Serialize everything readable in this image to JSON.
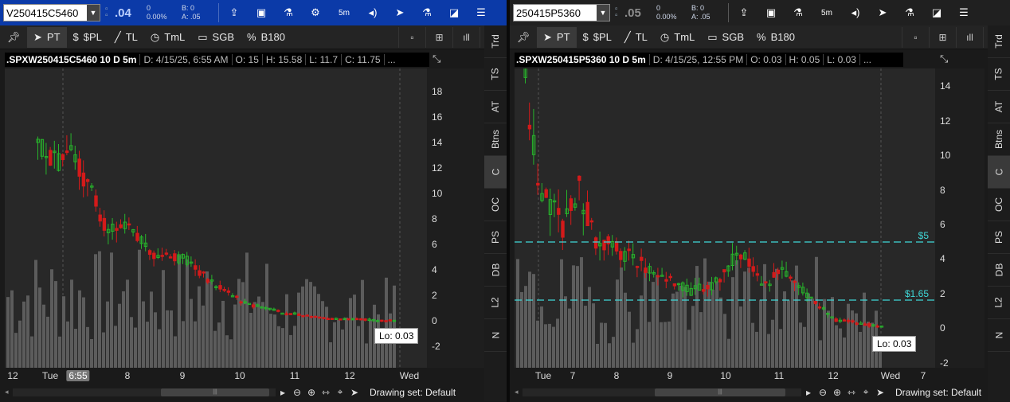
{
  "colors": {
    "up": "#27b32b",
    "down": "#d41a1a",
    "volume": "#5c5c5c",
    "level": "#3fd8d8",
    "link_blue": "#0b3aa8"
  },
  "left": {
    "symbol": "V250415C5460",
    "quote": {
      "last": ".04",
      "change": "0",
      "change_pct": "0.00%",
      "bid": "B: 0",
      "ask": "A: .05"
    },
    "timeframe": "5m",
    "tools": {
      "pt": "PT",
      "pl": "$PL",
      "tl": "TL",
      "tml": "TmL",
      "sgb": "SGB",
      "b180": "B180"
    },
    "header": {
      "symbol": ".SPXW250415C5460 10 D 5m",
      "date": "D: 4/15/25, 6:55 AM",
      "open": "O: 15",
      "high": "H: 15.58",
      "low": "L: 11.7",
      "close": "C: 11.75",
      "more": "..."
    },
    "x_labels": {
      "a": "12",
      "b": "Tue",
      "c": "6:55",
      "d": "8",
      "e": "9",
      "f": "10",
      "g": "11",
      "h": "12",
      "i": "Wed"
    },
    "y_labels": {
      "a": "18",
      "b": "16",
      "c": "14",
      "d": "12",
      "e": "10",
      "f": "8",
      "g": "6",
      "h": "4",
      "i": "2",
      "j": "0",
      "k": "-2"
    },
    "lo_label": "Lo: 0.03",
    "drawing_set": "Drawing set: Default",
    "side_tabs": {
      "trd": "Trd",
      "ts": "TS",
      "at": "AT",
      "btns": "Btns",
      "c": "C",
      "oc": "OC",
      "ps": "PS",
      "db": "DB",
      "l2": "L2",
      "n": "N"
    }
  },
  "right": {
    "symbol": "250415P5360",
    "quote": {
      "last": ".05",
      "change": "0",
      "change_pct": "0.00%",
      "bid": "B: 0",
      "ask": "A: .05"
    },
    "timeframe": "5m",
    "tools": {
      "pt": "PT",
      "pl": "$PL",
      "tl": "TL",
      "tml": "TmL",
      "sgb": "SGB",
      "b180": "B180"
    },
    "header": {
      "symbol": ".SPXW250415P5360 10 D 5m",
      "date": "D: 4/15/25, 12:55 PM",
      "open": "O: 0.03",
      "high": "H: 0.05",
      "low": "L: 0.03",
      "more": "..."
    },
    "x_labels": {
      "a": "Tue",
      "b": "7",
      "c": "8",
      "d": "9",
      "e": "10",
      "f": "11",
      "g": "12",
      "h": "Wed",
      "i": "7"
    },
    "y_labels": {
      "a": "14",
      "b": "12",
      "c": "10",
      "d": "8",
      "e": "6",
      "f": "4",
      "g": "2",
      "h": "0",
      "i": "-2"
    },
    "levels": {
      "a": "$5",
      "b": "$1.65"
    },
    "lo_label": "Lo: 0.03",
    "drawing_set": "Drawing set: Default",
    "side_tabs": {
      "trd": "Trd",
      "ts": "TS",
      "at": "AT",
      "btns": "Btns",
      "c": "C",
      "oc": "OC",
      "ps": "PS",
      "db": "DB",
      "l2": "L2",
      "n": "N"
    }
  }
}
